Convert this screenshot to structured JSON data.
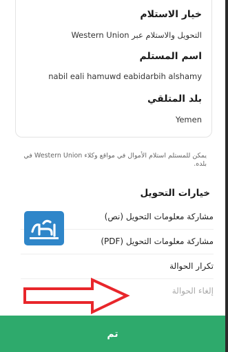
{
  "details": {
    "receive_option_label": "خيار الاستلام",
    "receive_option_value": "التحويل والاستلام عبر Western Union",
    "receiver_name_label": "اسم المستلم",
    "receiver_name_value": "nabil eali hamuwd eabidarbih alshamy",
    "receiver_country_label": "بلد المتلقي",
    "receiver_country_value": "Yemen"
  },
  "note": "يمكن للمستلم استلام الأموال في مواقع وكلاء Western Union في بلده.",
  "options": {
    "title": "خيارات التحويل",
    "items": [
      {
        "label": "مشاركة معلومات التحويل (نص)",
        "enabled": true
      },
      {
        "label": "مشاركة معلومات التحويل (PDF)",
        "enabled": true
      },
      {
        "label": "تكرار الحوالة",
        "enabled": true
      },
      {
        "label": "إلغاء الحوالة",
        "enabled": false
      }
    ]
  },
  "done_button": "تم",
  "colors": {
    "accent": "#2eaa6c",
    "watermark": "#2f86c9",
    "annotation_arrow": "#e8262b"
  },
  "icons": {
    "watermark": "site-logo-watermark",
    "arrow": "red-arrow-annotation"
  }
}
